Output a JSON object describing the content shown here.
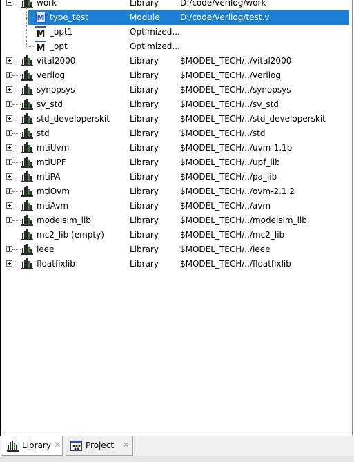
{
  "tree": {
    "rows": [
      {
        "name": "work",
        "type": "Library",
        "path": "D:/code/verilog/work"
      },
      {
        "name": "type_test",
        "type": "Module",
        "path": "D:/code/verilog/test.v"
      },
      {
        "name": "_opt1",
        "type": "Optimized...",
        "path": ""
      },
      {
        "name": "_opt",
        "type": "Optimized...",
        "path": ""
      },
      {
        "name": "vital2000",
        "type": "Library",
        "path": "$MODEL_TECH/../vital2000"
      },
      {
        "name": "verilog",
        "type": "Library",
        "path": "$MODEL_TECH/../verilog"
      },
      {
        "name": "synopsys",
        "type": "Library",
        "path": "$MODEL_TECH/../synopsys"
      },
      {
        "name": "sv_std",
        "type": "Library",
        "path": "$MODEL_TECH/../sv_std"
      },
      {
        "name": "std_developerskit",
        "type": "Library",
        "path": "$MODEL_TECH/../std_developerskit"
      },
      {
        "name": "std",
        "type": "Library",
        "path": "$MODEL_TECH/../std"
      },
      {
        "name": "mtiUvm",
        "type": "Library",
        "path": "$MODEL_TECH/../uvm-1.1b"
      },
      {
        "name": "mtiUPF",
        "type": "Library",
        "path": "$MODEL_TECH/../upf_lib"
      },
      {
        "name": "mtiPA",
        "type": "Library",
        "path": "$MODEL_TECH/../pa_lib"
      },
      {
        "name": "mtiOvm",
        "type": "Library",
        "path": "$MODEL_TECH/../ovm-2.1.2"
      },
      {
        "name": "mtiAvm",
        "type": "Library",
        "path": "$MODEL_TECH/../avm"
      },
      {
        "name": "modelsim_lib",
        "type": "Library",
        "path": "$MODEL_TECH/../modelsim_lib"
      },
      {
        "name": "mc2_lib  (empty)",
        "type": "Library",
        "path": "$MODEL_TECH/../mc2_lib"
      },
      {
        "name": "ieee",
        "type": "Library",
        "path": "$MODEL_TECH/../ieee"
      },
      {
        "name": "floatfixlib",
        "type": "Library",
        "path": "$MODEL_TECH/../floatfixlib"
      }
    ]
  },
  "tabs": [
    {
      "label": "Library",
      "icon": "library-icon",
      "close": "×"
    },
    {
      "label": "Project",
      "icon": "project-icon",
      "close": "×"
    }
  ],
  "colors": {
    "selection": "#1c7fd6",
    "library_bars": "#2a2a2a",
    "library_green": "#2e8b2e",
    "module_blue": "#2a56c6"
  }
}
